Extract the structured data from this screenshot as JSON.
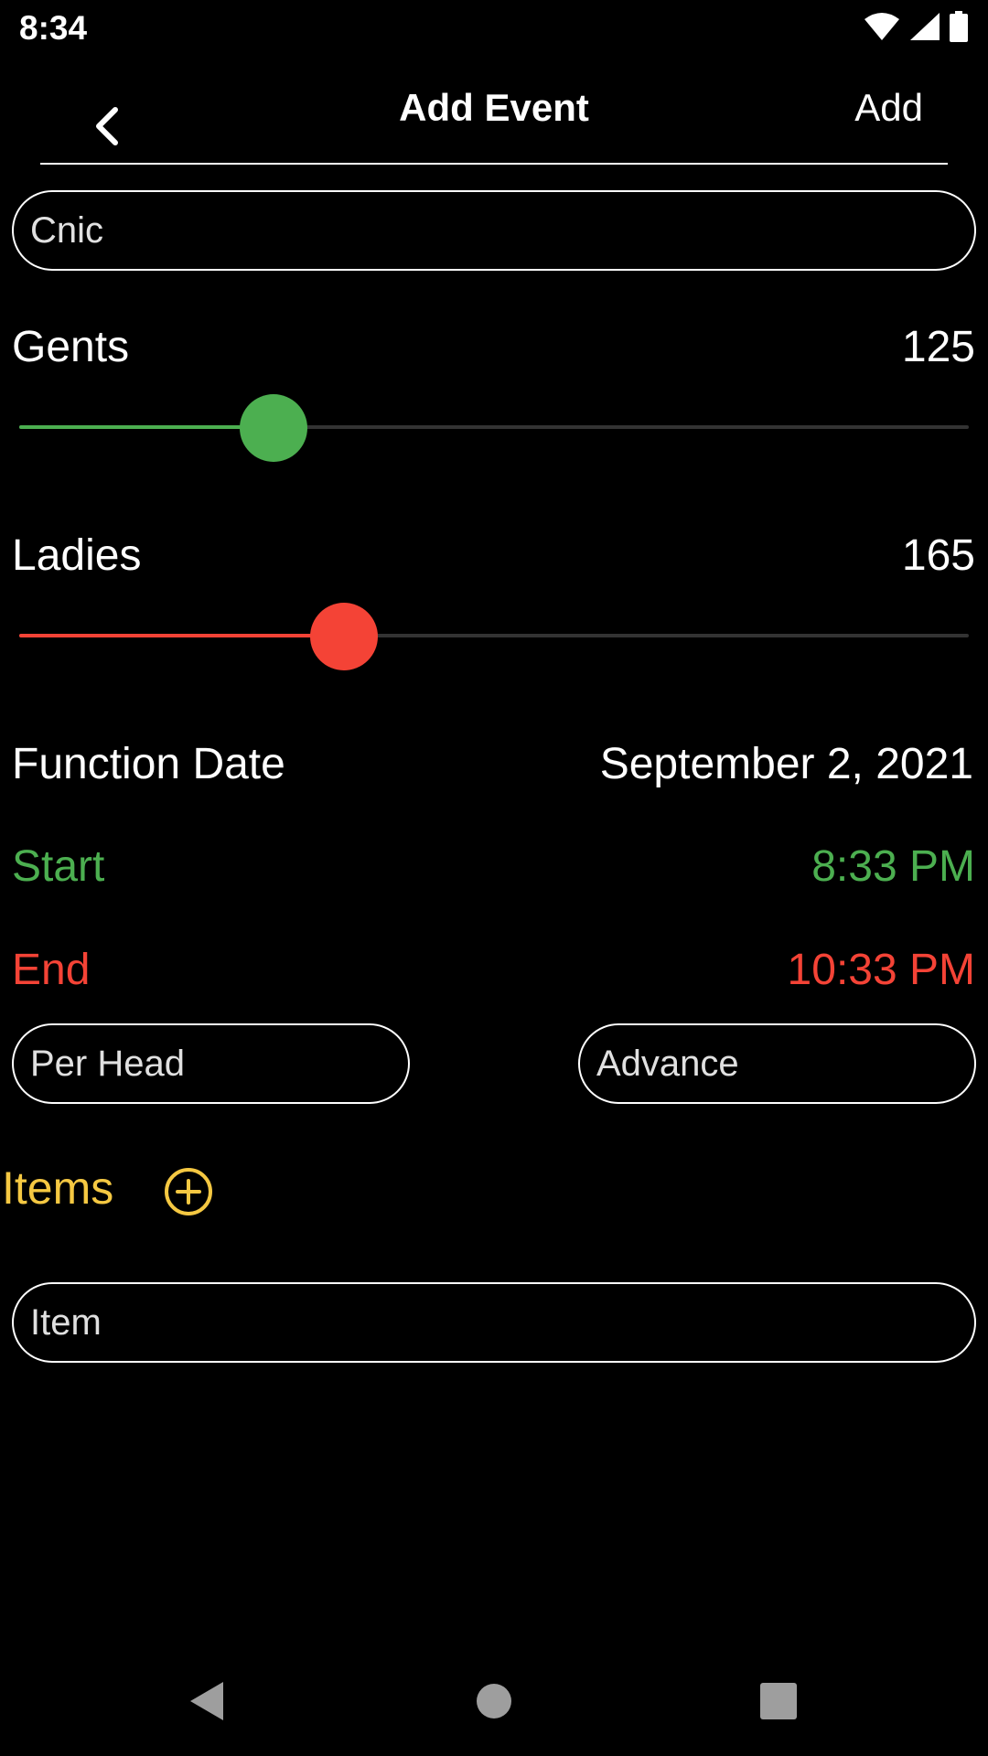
{
  "status_bar": {
    "time": "8:34",
    "icons": [
      "wifi-icon",
      "cellular-signal-icon",
      "battery-icon"
    ]
  },
  "app_bar": {
    "title": "Add Event",
    "action_label": "Add",
    "back_icon": "chevron-left-icon"
  },
  "form": {
    "name_field": {
      "value": "Cnic"
    },
    "gents": {
      "label": "Gents",
      "value": "125",
      "slider_fraction": 0.268,
      "color": "#4caf50"
    },
    "ladies": {
      "label": "Ladies",
      "value": "165",
      "slider_fraction": 0.342,
      "color": "#f44336"
    },
    "function_date": {
      "label": "Function Date",
      "value": "September 2, 2021"
    },
    "start": {
      "label": "Start",
      "value": "8:33 PM",
      "color": "#4caf50"
    },
    "end": {
      "label": "End",
      "value": "10:33 PM",
      "color": "#f44336"
    },
    "per_head": {
      "placeholder": "Per Head"
    },
    "advance": {
      "placeholder": "Advance"
    },
    "items": {
      "label": "Items",
      "add_icon": "add-circle-icon",
      "color": "#f5c842"
    },
    "item_field": {
      "placeholder": "Item"
    }
  },
  "nav_bar": {
    "icons": [
      "back-triangle-icon",
      "home-circle-icon",
      "recents-square-icon"
    ]
  }
}
